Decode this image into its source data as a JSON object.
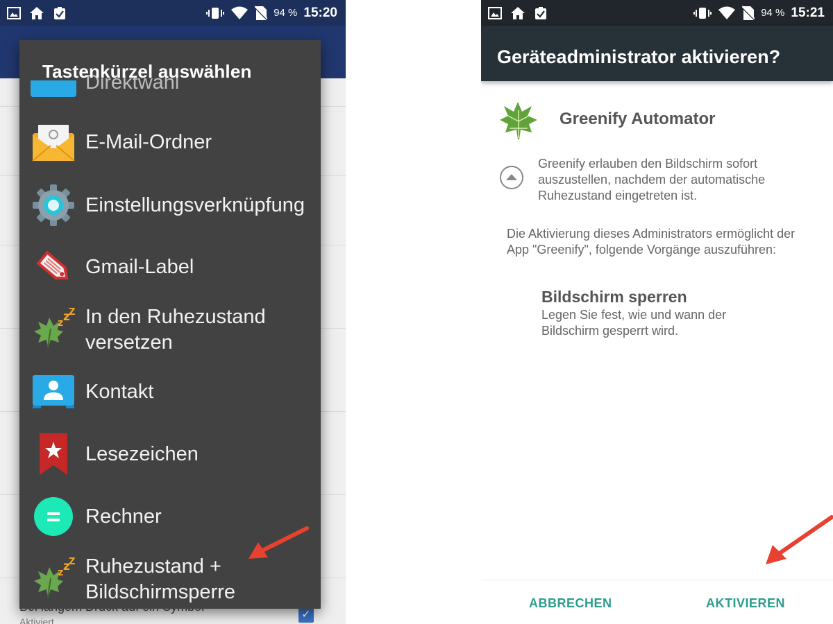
{
  "left_phone": {
    "status_bar": {
      "battery": "94 %",
      "time": "15:20"
    },
    "background_item": "Bei langem Druck auf ein Symbol",
    "background_item_sub": "Aktiviert",
    "dialog": {
      "title": "Tastenkürzel auswählen",
      "partial_item": "Direktwahl",
      "items": [
        {
          "label": "E-Mail-Ordner",
          "icon": "email-folder-icon"
        },
        {
          "label": "Einstellungsverknüpfung",
          "icon": "settings-gear-icon"
        },
        {
          "label": "Gmail-Label",
          "icon": "gmail-label-icon"
        },
        {
          "label": "In den Ruhezustand versetzen",
          "icon": "greenify-hibernate-icon"
        },
        {
          "label": "Kontakt",
          "icon": "contact-icon"
        },
        {
          "label": "Lesezeichen",
          "icon": "bookmark-icon"
        },
        {
          "label": "Rechner",
          "icon": "calculator-icon"
        },
        {
          "label": "Ruhezustand + Bildschirmsperre",
          "icon": "greenify-hibernate-lock-icon"
        }
      ]
    }
  },
  "right_phone": {
    "status_bar": {
      "battery": "94 %",
      "time": "15:21"
    },
    "title": "Geräteadministrator aktivieren?",
    "app_name": "Greenify Automator",
    "description": "Greenify erlauben den Bildschirm sofort auszustellen, nachdem der automatische Ruhezustand eingetreten ist.",
    "info": "Die Aktivierung dieses Administrators ermöglicht der App \"Greenify\", folgende Vorgänge auszuführen:",
    "policy_title": "Bildschirm sperren",
    "policy_desc": "Legen Sie fest, wie und wann der Bildschirm gesperrt wird.",
    "cancel_label": "ABBRECHEN",
    "activate_label": "AKTIVIEREN"
  },
  "colors": {
    "arrow": "#e8412f",
    "accent_teal": "#2c9d8c",
    "dialog_bg": "#424242"
  }
}
